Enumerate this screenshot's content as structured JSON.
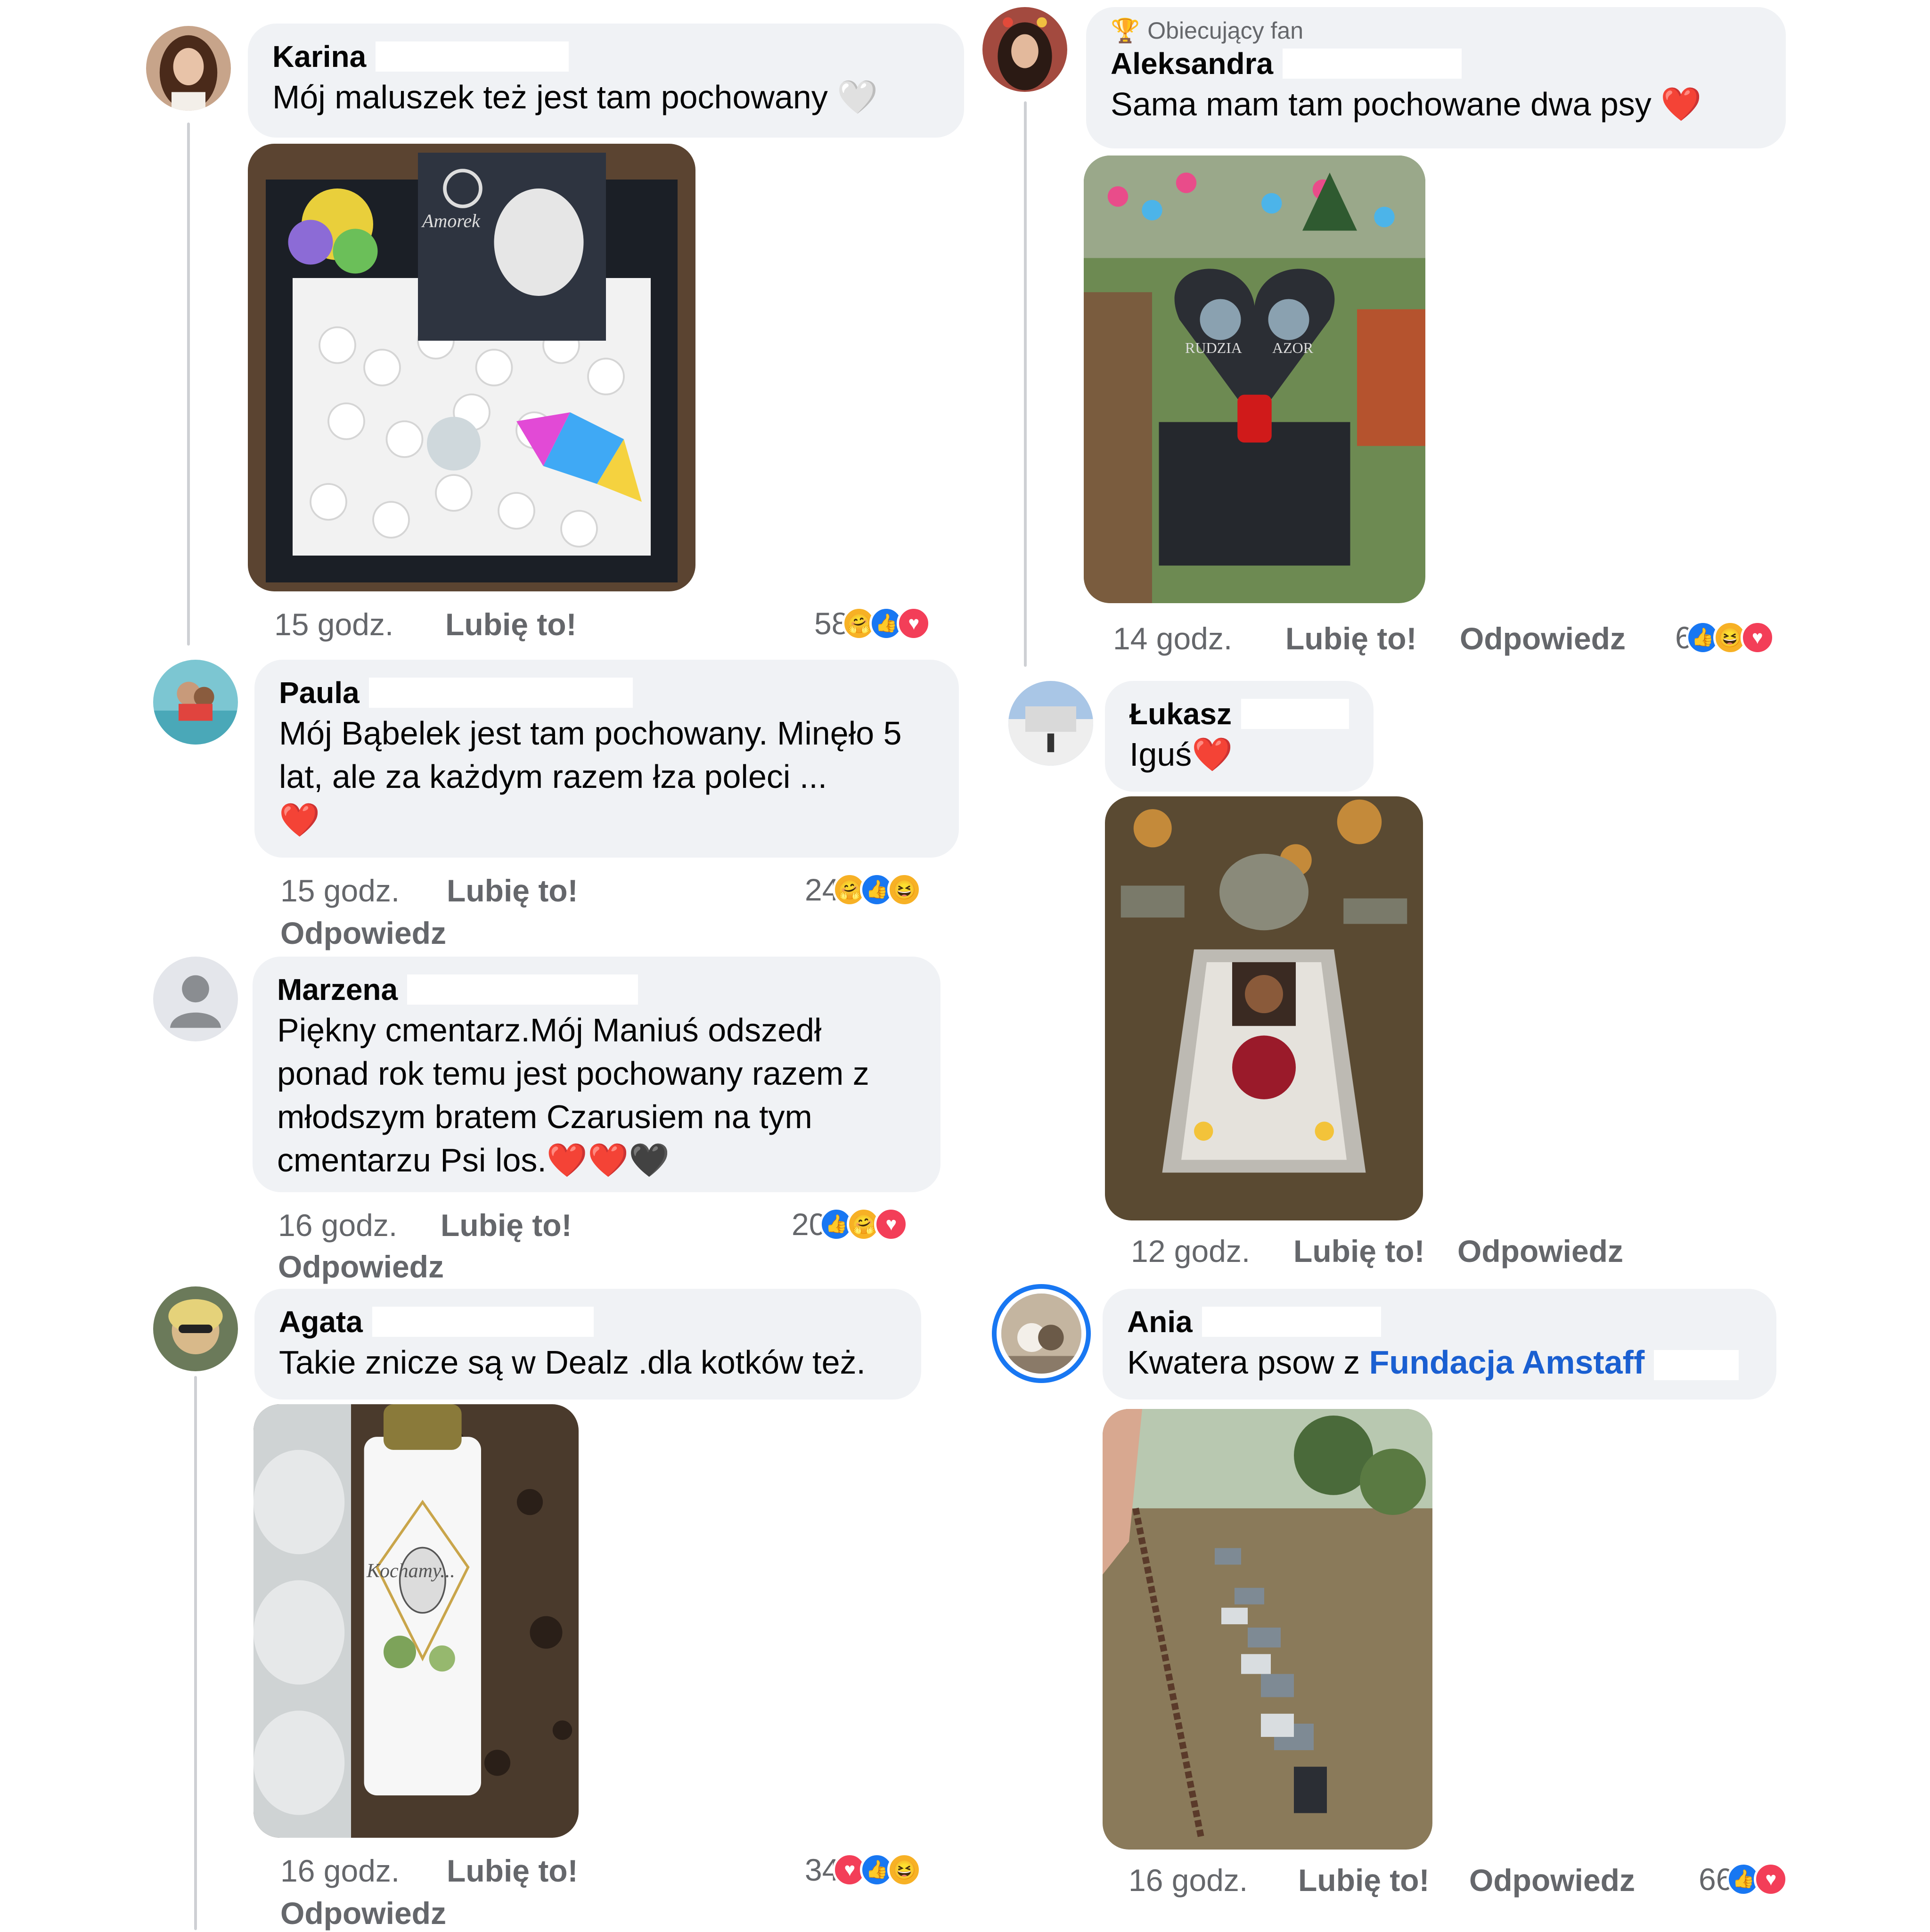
{
  "comments": [
    {
      "author": "Karina",
      "text": "Mój maluszek też jest tam pochowany",
      "emoji": "🤍",
      "time": "15 godz.",
      "like_label": "Lubię to!",
      "reaction_count": "58"
    },
    {
      "badge": "Obiecujący fan",
      "author": "Aleksandra",
      "text": "Sama mam tam pochowane dwa psy",
      "emoji": "❤️",
      "time": "14 godz.",
      "like_label": "Lubię to!",
      "reply_label": "Odpowiedz",
      "reaction_count": "6"
    },
    {
      "author": "Paula",
      "text": "Mój Bąbelek jest tam pochowany. Minęło 5 lat, ale za każdym razem łza poleci ...",
      "emoji": "❤️",
      "time": "15 godz.",
      "like_label": "Lubię to!",
      "reply_label": "Odpowiedz",
      "reaction_count": "24"
    },
    {
      "author": "Łukasz",
      "text": "Iguś",
      "emoji": "❤️",
      "time": "12 godz.",
      "like_label": "Lubię to!",
      "reply_label": "Odpowiedz"
    },
    {
      "author": "Marzena",
      "text": "Piękny cmentarz.Mój Maniuś odszedł ponad rok temu jest pochowany razem z młodszym bratem Czarusiem na tym cmentarzu Psi los.",
      "emoji": "❤️❤️🖤",
      "time": "16 godz.",
      "like_label": "Lubię to!",
      "reply_label": "Odpowiedz",
      "reaction_count": "20"
    },
    {
      "author": "Agata",
      "text": "Takie znicze są w Dealz .dla kotków też.",
      "time": "16 godz.",
      "like_label": "Lubię to!",
      "reply_label": "Odpowiedz",
      "reaction_count": "34"
    },
    {
      "author": "Ania",
      "text_prefix": "Kwatera psow z ",
      "link": "Fundacja Amstaff",
      "time": "16 godz.",
      "like_label": "Lubię to!",
      "reply_label": "Odpowiedz",
      "reaction_count": "66"
    }
  ],
  "photo_text": {
    "amorek": "Amorek",
    "rudzia": "RUDZIA",
    "azor": "AZOR",
    "candle": "Kochamy..."
  },
  "colors": {
    "like_blue": "#1877f2",
    "love_red": "#f33e58",
    "haha_yellow": "#f7b125",
    "bubble_gray": "#f0f2f5",
    "link_blue": "#1a5fd1"
  },
  "icons": {
    "like": "thumbs-up-icon",
    "love": "heart-icon",
    "haha": "laughing-face-icon",
    "care": "hugging-face-icon",
    "badge": "trophy-icon"
  }
}
